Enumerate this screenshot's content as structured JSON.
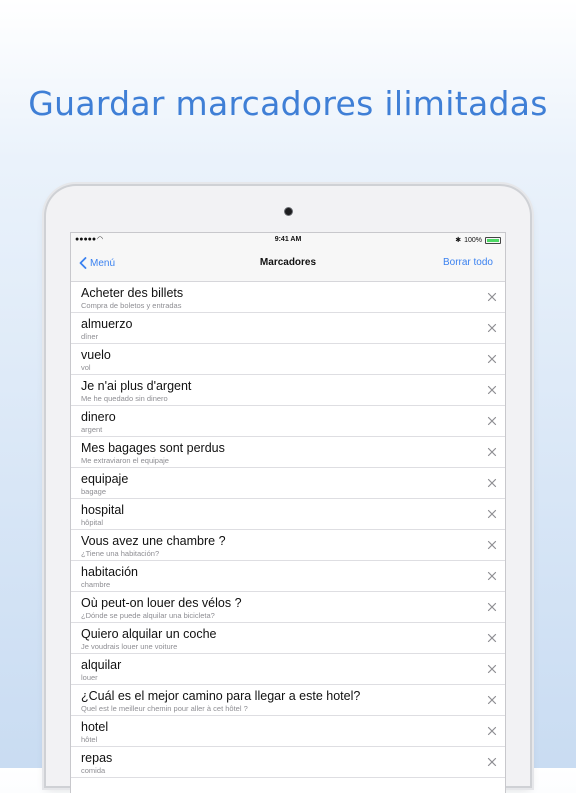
{
  "headline": "Guardar marcadores ilimitadas",
  "status_bar": {
    "signal": "●●●●●",
    "wifi": "◠",
    "time": "9:41 AM",
    "bluetooth": "✱",
    "battery_percent_label": "100%",
    "battery_level": 1.0
  },
  "nav": {
    "back_label": "Menú",
    "title": "Marcadores",
    "clear_label": "Borrar todo"
  },
  "bookmarks": [
    {
      "phrase": "Acheter des billets",
      "translation": "Compra de boletos y entradas"
    },
    {
      "phrase": "almuerzo",
      "translation": "dîner"
    },
    {
      "phrase": "vuelo",
      "translation": "vol"
    },
    {
      "phrase": "Je n'ai plus d'argent",
      "translation": "Me he quedado sin dinero"
    },
    {
      "phrase": "dinero",
      "translation": "argent"
    },
    {
      "phrase": "Mes bagages sont perdus",
      "translation": "Me extraviaron el equipaje"
    },
    {
      "phrase": "equipaje",
      "translation": "bagage"
    },
    {
      "phrase": "hospital",
      "translation": "hôpital"
    },
    {
      "phrase": "Vous avez une chambre ?",
      "translation": "¿Tiene una habitación?"
    },
    {
      "phrase": "habitación",
      "translation": "chambre"
    },
    {
      "phrase": "Où peut-on louer des vélos ?",
      "translation": "¿Dónde se puede alquilar una bicicleta?"
    },
    {
      "phrase": "Quiero alquilar un coche",
      "translation": "Je voudrais louer une voiture"
    },
    {
      "phrase": "alquilar",
      "translation": "louer"
    },
    {
      "phrase": "¿Cuál es el mejor camino para llegar a este hotel?",
      "translation": "Quel est le meilleur chemin pour aller à cet hôtel ?"
    },
    {
      "phrase": "hotel",
      "translation": "hôtel"
    },
    {
      "phrase": "repas",
      "translation": "comida"
    }
  ],
  "icons": {
    "back": "chevron-left-icon",
    "delete": "close-icon"
  },
  "colors": {
    "accent": "#3b82f0",
    "headline": "#3f7fd6",
    "battery": "#4cd964"
  }
}
